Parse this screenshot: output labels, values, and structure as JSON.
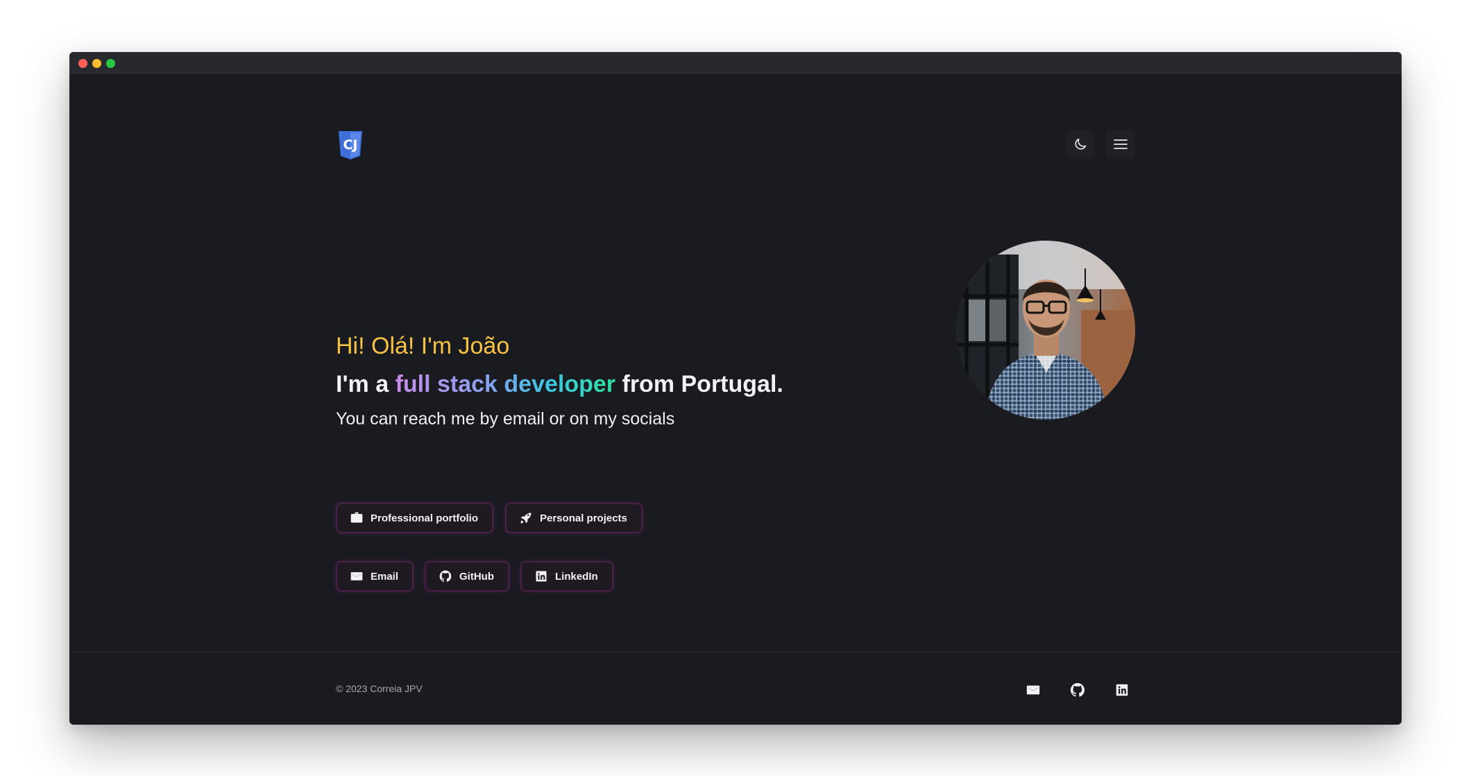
{
  "window": {
    "controls": [
      "close",
      "minimize",
      "maximize"
    ]
  },
  "header": {
    "logo_text": "CJ",
    "theme_toggle_icon": "moon-icon",
    "menu_icon": "hamburger-menu-icon"
  },
  "hero": {
    "greeting": "Hi! Olá! I'm João",
    "title_prefix": "I'm a ",
    "title_highlight": "full stack developer",
    "title_suffix": " from Portugal.",
    "subtitle": "You can reach me by email or on my socials",
    "avatar_alt": "Photo of João"
  },
  "buttons": {
    "professional_portfolio": "Professional portfolio",
    "personal_projects": "Personal projects",
    "email": "Email",
    "github": "GitHub",
    "linkedin": "LinkedIn"
  },
  "footer": {
    "copyright": "© 2023 Correia JPV",
    "icons": [
      "mail-icon",
      "github-icon",
      "linkedin-icon"
    ]
  },
  "colors": {
    "background": "#1a1b20",
    "greeting": "#f6c344",
    "gradient": [
      "#c98be8",
      "#8aa0f0",
      "#3cc6e0",
      "#2fe0a0"
    ],
    "button_border": "#4a2147",
    "logo": "#3f6fd8"
  }
}
